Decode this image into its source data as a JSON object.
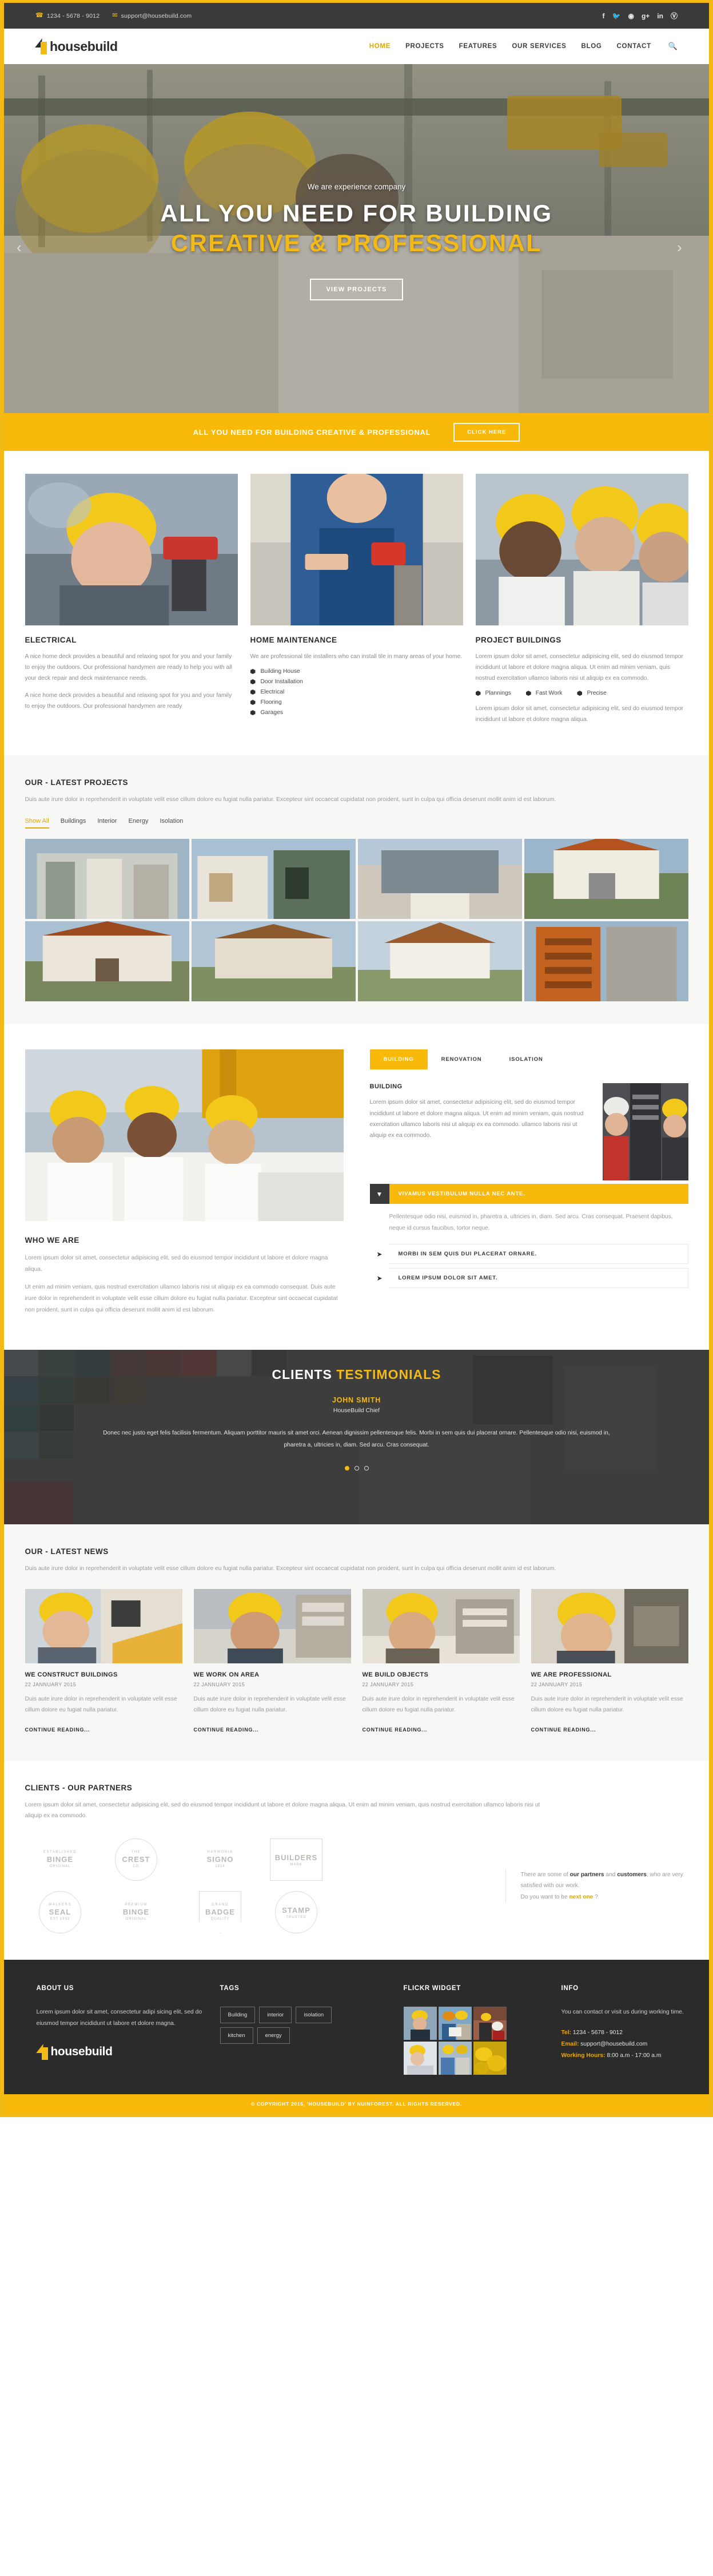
{
  "topbar": {
    "phone": "1234 - 5678 - 9012",
    "email": "support@housebuild.com",
    "phone_icon": "phone-icon",
    "email_icon": "envelope-icon",
    "social": [
      "f",
      "𝐓",
      "◠",
      "g+",
      "in",
      "ⓟ"
    ],
    "social_names": [
      "facebook-icon",
      "twitter-icon",
      "rss-icon",
      "google-plus-icon",
      "linkedin-icon",
      "pinterest-icon"
    ]
  },
  "nav": {
    "brand": "housebuild",
    "items": [
      {
        "label": "HOME",
        "active": true
      },
      {
        "label": "PROJECTS",
        "active": false
      },
      {
        "label": "FEATURES",
        "active": false
      },
      {
        "label": "OUR SERVICES",
        "active": false
      },
      {
        "label": "BLOG",
        "active": false
      },
      {
        "label": "CONTACT",
        "active": false
      }
    ],
    "search_icon": "search-icon"
  },
  "hero": {
    "kicker": "We are experience company",
    "line1": "ALL YOU NEED FOR BUILDING",
    "line2": "CREATIVE & PROFESSIONAL",
    "button": "VIEW PROJECTS"
  },
  "cta": {
    "text": "ALL YOU NEED FOR BUILDING CREATIVE & PROFESSIONAL",
    "button": "CLICK HERE"
  },
  "services": [
    {
      "title": "ELECTRICAL",
      "p1": "A nice home deck provides a beautiful and relaxing spot for you and your family to enjoy the outdoors. Our professional handymen are ready to help you with all your deck repair and deck maintenance needs.",
      "p2": "A nice home deck provides a beautiful and relaxing spot for you and your family to enjoy the outdoors. Our professional handymen are ready"
    },
    {
      "title": "HOME MAINTENANCE",
      "p1": "We are professional tile installers who can install tile in many areas of your home.",
      "list": [
        "Building House",
        "Door Installation",
        "Electrical",
        "Flooring",
        "Garages"
      ]
    },
    {
      "title": "PROJECT BUILDINGS",
      "p1": "Lorem ipsum dolor sit amet, consectetur adipisicing elit, sed do eiusmod tempor incididunt ut labore et dolore magna aliqua. Ut enim ad minim veniam, quis nostrud exercitation ullamco laboris nisi ut aliquip ex ea commodo.",
      "inline": [
        "Plannings",
        "Fast Work",
        "Precise"
      ],
      "p2": "Lorem ipsum dolor sit amet, consectetur adipisicing elit, sed do eiusmod tempor incididunt ut labore et dolore magna aliqua."
    }
  ],
  "projects": {
    "title": "OUR - LATEST PROJECTS",
    "subtitle": "Duis aute irure dolor in reprehenderit in voluptate velit esse cillum dolore eu fugiat nulla pariatur. Excepteur sint occaecat cupidatat non proident, sunt in culpa qui officia deserunt mollit anim id est laborum.",
    "filters": [
      {
        "label": "Show All",
        "active": true
      },
      {
        "label": "Buildings",
        "active": false
      },
      {
        "label": "Interior",
        "active": false
      },
      {
        "label": "Energy",
        "active": false
      },
      {
        "label": "Isolation",
        "active": false
      }
    ]
  },
  "about": {
    "tabs": [
      {
        "label": "BUILDING",
        "active": true
      },
      {
        "label": "RENOVATION",
        "active": false
      },
      {
        "label": "ISOLATION",
        "active": false
      }
    ],
    "panel_title": "BUILDING",
    "panel_text": "Lorem ipsum dolor sit amet, consectetur adipisicing elit, sed do eiusmod tempor incididunt ut labore et dolore magna aliqua. Ut enim ad minim veniam, quis nostrud exercitation ullamco laboris nisi ut aliquip ex ea commodo. ullamco laboris nisi ut aliquip ex ea commodo.",
    "who_title": "WHO WE ARE",
    "who_p1": "Lorem ipsum dolor sit amet, consectetur adipisicing elit, sed do eiusmod tempor incididunt ut labore et dolore magna aliqua.",
    "who_p2": "Ut enim ad minim veniam, quis nostrud exercitation ullamco laboris nisi ut aliquip ex ea commodo consequat. Duis aute irure dolor in reprehenderit in voluptate velit esse cillum dolore eu fugiat nulla pariatur. Excepteur sint occaecat cupidatat non proident, sunt in culpa qui officia deserunt mollit anim id est laborum.",
    "accordion": [
      {
        "label": "VIVAMUS VESTIBULUM NULLA NEC ANTE.",
        "open": true,
        "body": "Pellentesque odio nisi, euismod in, pharetra a, ultricies in, diam. Sed arcu. Cras consequat. Praesent dapibus, neque id cursus faucibus, tortor neque."
      },
      {
        "label": "MORBI IN SEM QUIS DUI PLACERAT ORNARE.",
        "open": false,
        "body": ""
      },
      {
        "label": "LOREM IPSUM DOLOR SIT AMET.",
        "open": false,
        "body": ""
      }
    ]
  },
  "testimonials": {
    "title_white": "CLIENTS",
    "title_yellow": "TESTIMONIALS",
    "name": "JOHN SMITH",
    "role": "HouseBuild Chief",
    "quote": "Donec nec justo eget felis facilisis fermentum. Aliquam porttitor mauris sit amet orci. Aenean dignissim pellentesque felis. Morbi in sem quis dui placerat ornare. Pellentesque odio nisi, euismod in, pharetra a, ultricies in, diam. Sed arcu. Cras consequat.",
    "dots": [
      true,
      false,
      false
    ]
  },
  "news": {
    "title": "OUR - LATEST NEWS",
    "subtitle": "Duis aute irure dolor in reprehenderit in voluptate velit esse cillum dolore eu fugiat nulla pariatur. Excepteur sint occaecat cupidatat non proident, sunt in culpa qui officia deserunt mollit anim id est laborum.",
    "items": [
      {
        "title": "WE CONSTRUCT BUILDINGS",
        "date": "22 JANNUARY 2015",
        "text": "Duis aute irure dolor in reprehenderit in voluptate velit esse cillum dolore eu fugiat nulla pariatur.",
        "more": "CONTINUE READING..."
      },
      {
        "title": "WE WORK ON AREA",
        "date": "22 JANNUARY 2015",
        "text": "Duis aute irure dolor in reprehenderit in voluptate velit esse cillum dolore eu fugiat nulla pariatur.",
        "more": "CONTINUE READING..."
      },
      {
        "title": "WE BUILD OBJECTS",
        "date": "22 JANNUARY 2015",
        "text": "Duis aute irure dolor in reprehenderit in voluptate velit esse cillum dolore eu fugiat nulla pariatur.",
        "more": "CONTINUE READING..."
      },
      {
        "title": "WE ARE PROFESSIONAL",
        "date": "22 JANNUARY 2015",
        "text": "Duis aute irure dolor in reprehenderit in voluptate velit esse cillum dolore eu fugiat nulla pariatur.",
        "more": "CONTINUE READING..."
      }
    ]
  },
  "partners": {
    "title": "CLIENTS - OUR PARTNERS",
    "subtitle": "Lorem ipsum dolor sit amet, consectetur adipisicing elit, sed do eiusmod tempor incididunt ut labore et dolore magna aliqua. Ut enim ad minim veniam, quis nostrud exercitation ullamco laboris nisi ut aliquip ex ea commodo.",
    "logos": [
      {
        "l1": "ESTABLISHED",
        "l2": "BINGE",
        "l3": "ORIGINAL",
        "shape": "plain"
      },
      {
        "l1": "THE",
        "l2": "CREST",
        "l3": "CO",
        "shape": "circ"
      },
      {
        "l1": "HARMONIA",
        "l2": "SIGNO",
        "l3": "1924",
        "shape": "plain"
      },
      {
        "l1": "",
        "l2": "BUILDERS",
        "l3": "MARK",
        "shape": "rect"
      },
      {
        "l1": "WALKERS",
        "l2": "SEAL",
        "l3": "EST 1932",
        "shape": "circ"
      },
      {
        "l1": "PREMIUM",
        "l2": "BINGE",
        "l3": "ORIGINAL",
        "shape": "plain"
      },
      {
        "l1": "GRAND",
        "l2": "BADGE",
        "l3": "QUALITY",
        "shape": "shield"
      },
      {
        "l1": "",
        "l2": "STAMP",
        "l3": "TRUSTED",
        "shape": "circ"
      }
    ],
    "note_pre": "There are some of ",
    "note_b1": "our partners",
    "note_mid": " and ",
    "note_b2": "customers",
    "note_post": ", who are very satisfied with our work.",
    "note_line2_pre": "Do you want to be ",
    "note_next": "next one",
    "note_line2_post": " ?"
  },
  "footer": {
    "about": {
      "heading": "ABOUT US",
      "text": "Lorem ipsum dolor sit amet, consectetur adipi sicing elit, sed do eiusmod tempor incididunt ut labore et dolore magna.",
      "brand": "housebuild"
    },
    "tags": {
      "heading": "TAGS",
      "items": [
        "Building",
        "interior",
        "isolation",
        "kitchen",
        "energy"
      ]
    },
    "flickr": {
      "heading": "FLICKR WIDGET"
    },
    "info": {
      "heading": "INFO",
      "text": "You can contact or visit us during working time.",
      "tel_label": "Tel:",
      "tel_value": "1234 - 5678 - 9012",
      "email_label": "Email:",
      "email_value": "support@housebuild.com",
      "hours_label": "Working Hours:",
      "hours_value": "8:00 a.m - 17:00 a.m"
    }
  },
  "copyright": "© COPYRIGHT 2015, 'HOUSEBUILD' BY NUINFOREST. ALL RIGHTS RESERVED.",
  "colors": {
    "accent": "#f3ba16",
    "accent_dark": "#e0a800",
    "dark": "#2b2b2b",
    "topbar": "#3a3a3a"
  }
}
